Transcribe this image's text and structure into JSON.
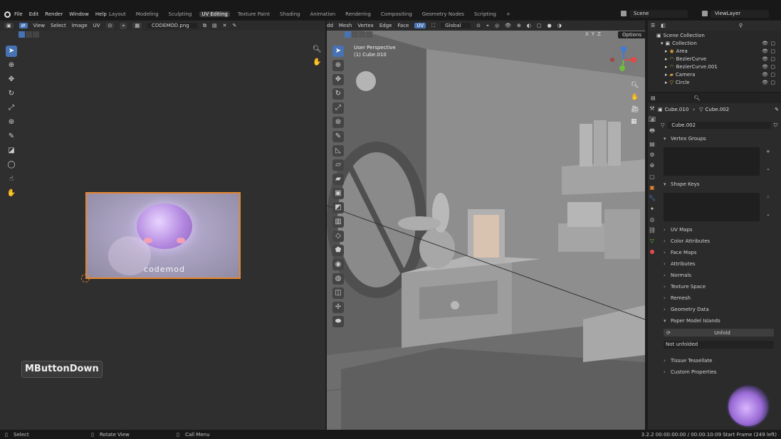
{
  "menubar": {
    "items": [
      "File",
      "Edit",
      "Render",
      "Window",
      "Help"
    ],
    "workspaces": [
      "Layout",
      "Modeling",
      "Sculpting",
      "UV Editing",
      "Texture Paint",
      "Shading",
      "Animation",
      "Rendering",
      "Compositing",
      "Geometry Nodes",
      "Scripting"
    ],
    "active_workspace": "UV Editing",
    "add_tab": "+",
    "scene_label": "Scene",
    "viewlayer_label": "ViewLayer"
  },
  "uv_editor": {
    "menus": [
      "View",
      "Select",
      "Image",
      "UV"
    ],
    "image_name": "CODEMOD.png",
    "image_logo_text": "codemod",
    "key_overlay": "MButtonDown"
  },
  "viewport": {
    "menus": [
      "dd",
      "Mesh",
      "Vertex",
      "Edge",
      "Face",
      "UV"
    ],
    "active_menu": "UV",
    "orientation": "Global",
    "options_label": "Options",
    "axis_labels": [
      "X",
      "Y",
      "Z"
    ],
    "perspective_text": "User Perspective",
    "object_text": "(1) Cube.010"
  },
  "outliner": {
    "search_placeholder": "",
    "root": "Scene Collection",
    "collection": "Collection",
    "items": [
      {
        "name": "Area",
        "color": "#e3a43d"
      },
      {
        "name": "BezierCurve",
        "color": "#e3a43d"
      },
      {
        "name": "BezierCurve.001",
        "color": "#e3a43d"
      },
      {
        "name": "Camera",
        "color": "#e3a43d"
      },
      {
        "name": "Circle",
        "color": "#e3a43d"
      }
    ]
  },
  "properties": {
    "breadcrumb_object": "Cube.010",
    "breadcrumb_data": "Cube.002",
    "data_name": "Cube.002",
    "sections": {
      "vertex_groups": "Vertex Groups",
      "shape_keys": "Shape Keys",
      "uv_maps": "UV Maps",
      "color_attributes": "Color Attributes",
      "face_maps": "Face Maps",
      "attributes": "Attributes",
      "normals": "Normals",
      "texture_space": "Texture Space",
      "remesh": "Remesh",
      "geometry_data": "Geometry Data",
      "paper_model": "Paper Model Islands",
      "tissue": "Tissue Tessellate",
      "custom_props": "Custom Properties"
    },
    "unfold_label": "Unfold",
    "not_unfolded": "Not unfolded"
  },
  "statusbar": {
    "select": "Select",
    "rotate": "Rotate View",
    "call_menu": "Call Menu",
    "info": "3.2.2  00:00:00:00 / 00:00:10:09  Start Frame (249 left)"
  },
  "colors": {
    "accent": "#4772b3",
    "selection": "#e8872e",
    "panel": "#2b2b2b",
    "bg": "#1d1d1d"
  }
}
